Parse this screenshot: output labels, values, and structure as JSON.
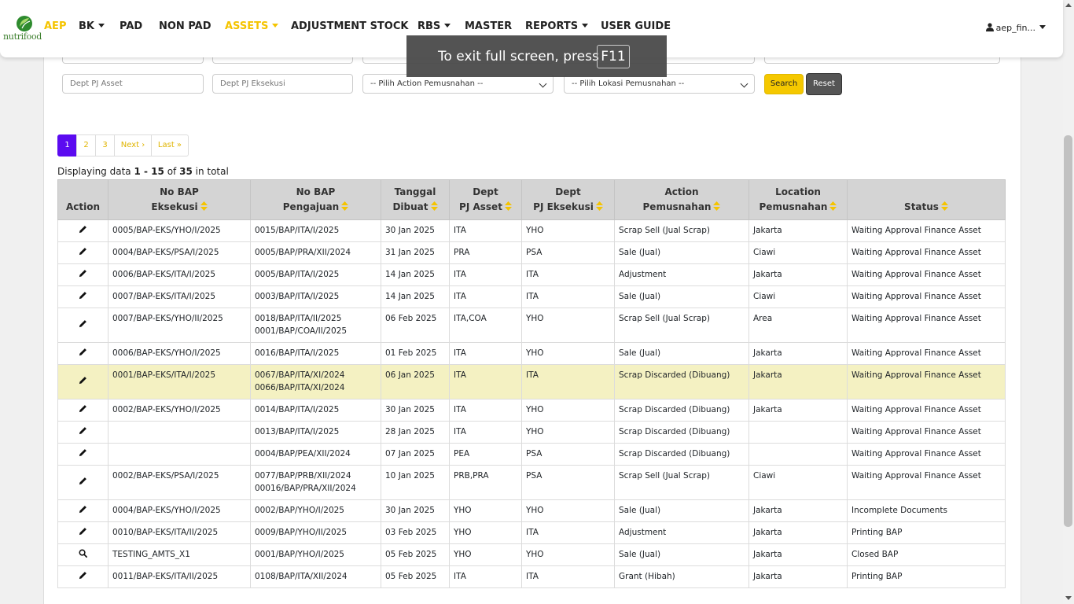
{
  "brand": {
    "logo_text": "nutrifood"
  },
  "nav": {
    "items": [
      {
        "label": "AEP",
        "active": true,
        "dropdown": false
      },
      {
        "label": "BK",
        "active": false,
        "dropdown": true
      },
      {
        "label": "PAD",
        "active": false,
        "dropdown": false
      },
      {
        "label": "NON PAD",
        "active": false,
        "dropdown": false
      },
      {
        "label": "ASSETS",
        "active": true,
        "dropdown": true
      },
      {
        "label": "ADJUSTMENT STOCK",
        "active": false,
        "dropdown": false
      },
      {
        "label": "RBS",
        "active": false,
        "dropdown": true
      },
      {
        "label": "MASTER",
        "active": false,
        "dropdown": false
      },
      {
        "label": "REPORTS",
        "active": false,
        "dropdown": true
      },
      {
        "label": "USER GUIDE",
        "active": false,
        "dropdown": false
      }
    ],
    "user": "aep_fin..."
  },
  "toast": {
    "text": "To exit full screen, press",
    "key": "F11"
  },
  "filters": {
    "dept_pj_asset_placeholder": "Dept PJ Asset",
    "dept_pj_eksekusi_placeholder": "Dept PJ Eksekusi",
    "action_select": "-- Pilih Action Pemusnahan --",
    "lokasi_select": "-- Pilih Lokasi Pemusnahan --",
    "search_label": "Search",
    "reset_label": "Reset"
  },
  "pagination": {
    "pages": [
      "1",
      "2",
      "3"
    ],
    "current": "1",
    "next_label": "Next ›",
    "last_label": "Last »"
  },
  "summary": {
    "prefix": "Displaying data",
    "range": "1 - 15",
    "of_word": "of",
    "total": "35",
    "suffix": "in total"
  },
  "table": {
    "headers": [
      {
        "line1": "",
        "line2": "Action",
        "sortable": false
      },
      {
        "line1": "No BAP",
        "line2": "Eksekusi",
        "sortable": true
      },
      {
        "line1": "No BAP",
        "line2": "Pengajuan",
        "sortable": true
      },
      {
        "line1": "Tanggal",
        "line2": "Dibuat",
        "sortable": true
      },
      {
        "line1": "Dept",
        "line2": "PJ Asset",
        "sortable": true
      },
      {
        "line1": "Dept",
        "line2": "PJ Eksekusi",
        "sortable": true
      },
      {
        "line1": "Action",
        "line2": "Pemusnahan",
        "sortable": true
      },
      {
        "line1": "Location",
        "line2": "Pemusnahan",
        "sortable": true
      },
      {
        "line1": "",
        "line2": "Status",
        "sortable": true
      }
    ],
    "rows": [
      {
        "icon": "pencil-icon",
        "eks": "0005/BAP-EKS/YHO/I/2025",
        "peng": [
          "0015/BAP/ITA/I/2025"
        ],
        "tgl": "30 Jan 2025",
        "asset": "ITA",
        "eksdept": "YHO",
        "action": "Scrap Sell (Jual Scrap)",
        "loc": "Jakarta",
        "status": "Waiting Approval Finance Asset",
        "highlight": false
      },
      {
        "icon": "pencil-icon",
        "eks": "0004/BAP-EKS/PSA/I/2025",
        "peng": [
          "0005/BAP/PRA/XII/2024"
        ],
        "tgl": "31 Jan 2025",
        "asset": "PRA",
        "eksdept": "PSA",
        "action": "Sale (Jual)",
        "loc": "Ciawi",
        "status": "Waiting Approval Finance Asset",
        "highlight": false
      },
      {
        "icon": "pencil-icon",
        "eks": "0006/BAP-EKS/ITA/I/2025",
        "peng": [
          "0005/BAP/ITA/I/2025"
        ],
        "tgl": "14 Jan 2025",
        "asset": "ITA",
        "eksdept": "ITA",
        "action": "Adjustment",
        "loc": "Jakarta",
        "status": "Waiting Approval Finance Asset",
        "highlight": false
      },
      {
        "icon": "pencil-icon",
        "eks": "0007/BAP-EKS/ITA/I/2025",
        "peng": [
          "0003/BAP/ITA/I/2025"
        ],
        "tgl": "14 Jan 2025",
        "asset": "ITA",
        "eksdept": "ITA",
        "action": "Sale (Jual)",
        "loc": "Ciawi",
        "status": "Waiting Approval Finance Asset",
        "highlight": false
      },
      {
        "icon": "pencil-icon",
        "eks": "0007/BAP-EKS/YHO/II/2025",
        "peng": [
          "0018/BAP/ITA/II/2025",
          "0001/BAP/COA/II/2025"
        ],
        "tgl": "06 Feb 2025",
        "asset": "ITA,COA",
        "eksdept": "YHO",
        "action": "Scrap Sell (Jual Scrap)",
        "loc": "Area",
        "status": "Waiting Approval Finance Asset",
        "highlight": false
      },
      {
        "icon": "pencil-icon",
        "eks": "0006/BAP-EKS/YHO/I/2025",
        "peng": [
          "0016/BAP/ITA/I/2025"
        ],
        "tgl": "01 Feb 2025",
        "asset": "ITA",
        "eksdept": "YHO",
        "action": "Sale (Jual)",
        "loc": "Jakarta",
        "status": "Waiting Approval Finance Asset",
        "highlight": false
      },
      {
        "icon": "pencil-icon",
        "eks": "0001/BAP-EKS/ITA/I/2025",
        "peng": [
          "0067/BAP/ITA/XI/2024",
          "0066/BAP/ITA/XI/2024"
        ],
        "tgl": "06 Jan 2025",
        "asset": "ITA",
        "eksdept": "ITA",
        "action": "Scrap Discarded (Dibuang)",
        "loc": "Jakarta",
        "status": "Waiting Approval Finance Asset",
        "highlight": true
      },
      {
        "icon": "pencil-icon",
        "eks": "0002/BAP-EKS/YHO/I/2025",
        "peng": [
          "0014/BAP/ITA/I/2025"
        ],
        "tgl": "30 Jan 2025",
        "asset": "ITA",
        "eksdept": "YHO",
        "action": "Scrap Discarded (Dibuang)",
        "loc": "Jakarta",
        "status": "Waiting Approval Finance Asset",
        "highlight": false
      },
      {
        "icon": "pencil-icon",
        "eks": "",
        "peng": [
          "0013/BAP/ITA/I/2025"
        ],
        "tgl": "28 Jan 2025",
        "asset": "ITA",
        "eksdept": "YHO",
        "action": "Scrap Discarded (Dibuang)",
        "loc": "",
        "status": "Waiting Approval Finance Asset",
        "highlight": false
      },
      {
        "icon": "pencil-icon",
        "eks": "",
        "peng": [
          "0004/BAP/PEA/XII/2024"
        ],
        "tgl": "07 Jan 2025",
        "asset": "PEA",
        "eksdept": "PSA",
        "action": "Scrap Discarded (Dibuang)",
        "loc": "",
        "status": "Waiting Approval Finance Asset",
        "highlight": false
      },
      {
        "icon": "pencil-icon",
        "eks": "0002/BAP-EKS/PSA/I/2025",
        "peng": [
          "0077/BAP/PRB/XII/2024",
          "00016/BAP/PRA/XII/2024"
        ],
        "tgl": "10 Jan 2025",
        "asset": "PRB,PRA",
        "eksdept": "PSA",
        "action": "Scrap Sell (Jual Scrap)",
        "loc": "Ciawi",
        "status": "Waiting Approval Finance Asset",
        "highlight": false
      },
      {
        "icon": "pencil-icon",
        "eks": "0004/BAP-EKS/YHO/I/2025",
        "peng": [
          "0002/BAP/YHO/I/2025"
        ],
        "tgl": "30 Jan 2025",
        "asset": "YHO",
        "eksdept": "YHO",
        "action": "Sale (Jual)",
        "loc": "Jakarta",
        "status": "Incomplete Documents",
        "highlight": false
      },
      {
        "icon": "pencil-icon",
        "eks": "0010/BAP-EKS/ITA/II/2025",
        "peng": [
          "0009/BAP/YHO/II/2025"
        ],
        "tgl": "03 Feb 2025",
        "asset": "YHO",
        "eksdept": "ITA",
        "action": "Adjustment",
        "loc": "Jakarta",
        "status": "Printing BAP",
        "highlight": false
      },
      {
        "icon": "search-icon",
        "eks": "TESTING_AMTS_X1",
        "peng": [
          "0001/BAP/YHO/I/2025"
        ],
        "tgl": "05 Feb 2025",
        "asset": "YHO",
        "eksdept": "YHO",
        "action": "Sale (Jual)",
        "loc": "Jakarta",
        "status": "Closed BAP",
        "highlight": false
      },
      {
        "icon": "pencil-icon",
        "eks": "0011/BAP-EKS/ITA/II/2025",
        "peng": [
          "0108/BAP/ITA/XII/2024"
        ],
        "tgl": "05 Feb 2025",
        "asset": "ITA",
        "eksdept": "ITA",
        "action": "Grant (Hibah)",
        "loc": "Jakarta",
        "status": "Printing BAP",
        "highlight": false
      }
    ]
  },
  "colors": {
    "accent": "#f5c400",
    "page_active": "#5b0bf0",
    "row_highlight": "#f4f1c2",
    "header_bg": "#d4d4d4"
  }
}
